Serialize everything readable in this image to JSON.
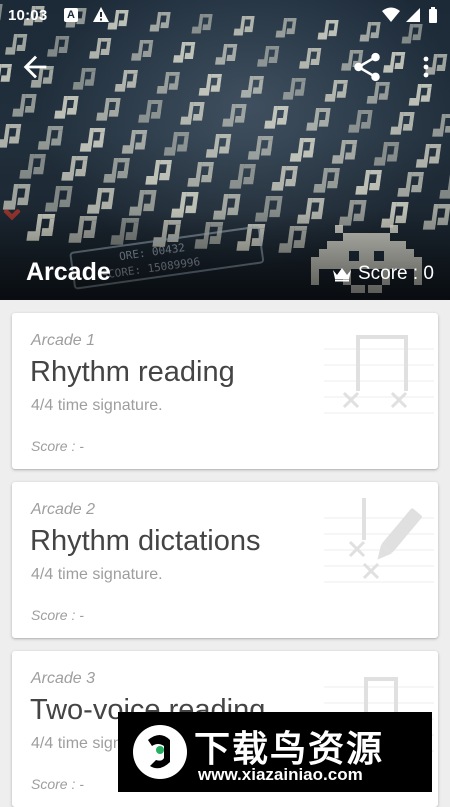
{
  "status_bar": {
    "time": "10:03",
    "a_badge": "A"
  },
  "header": {
    "title": "Arcade",
    "score_label": "Score : 0",
    "art_text_line1": "ORE: 00432",
    "art_text_line2": "SCORE: 15089996"
  },
  "cards": [
    {
      "subtitle": "Arcade 1",
      "title": "Rhythm reading",
      "description": "4/4 time signature.",
      "score": "Score : -"
    },
    {
      "subtitle": "Arcade 2",
      "title": "Rhythm dictations",
      "description": "4/4 time signature.",
      "score": "Score : -"
    },
    {
      "subtitle": "Arcade 3",
      "title": "Two-voice reading",
      "description": "4/4 time signature.",
      "score": "Score : -"
    }
  ],
  "watermark": {
    "brand": "下载鸟资源",
    "url": "www.xiazainiao.com"
  },
  "icons": {
    "back": "arrow-back-icon",
    "share": "share-icon",
    "more": "more-vert-icon",
    "crown": "crown-icon",
    "card1": "notes-icon",
    "card2": "note-pencil-icon",
    "card3": "two-voice-icon"
  }
}
